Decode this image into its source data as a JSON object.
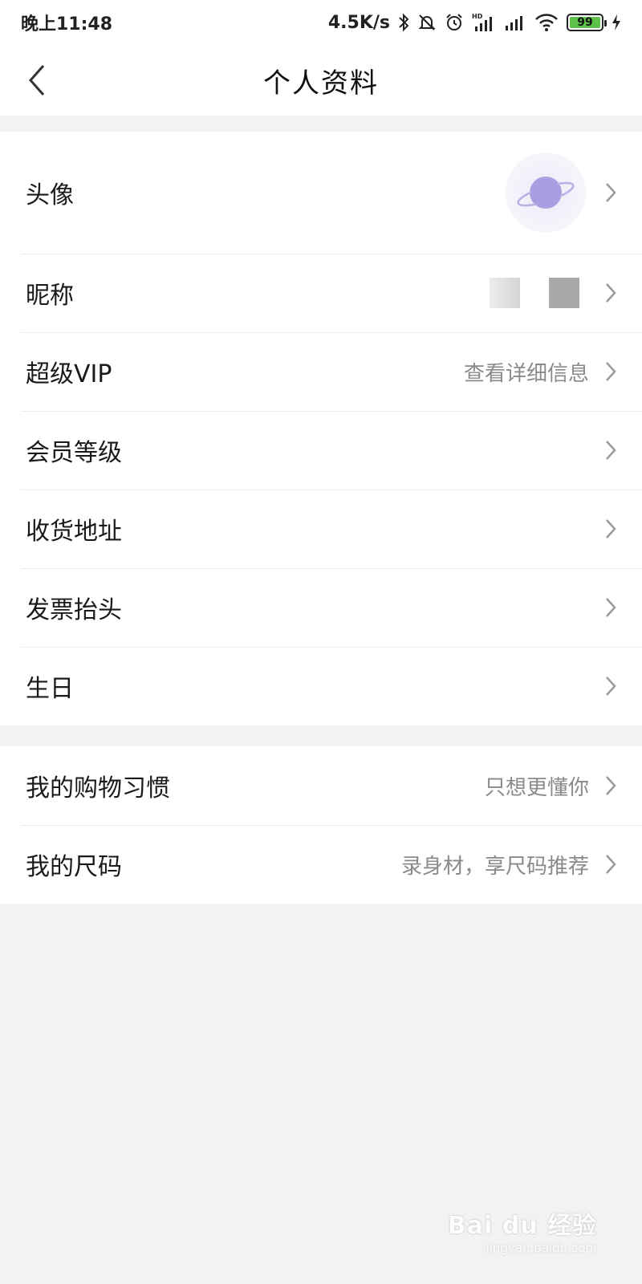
{
  "status_bar": {
    "time": "晚上11:48",
    "speed": "4.5K/s",
    "battery": "99"
  },
  "header": {
    "title": "个人资料"
  },
  "profile_items": [
    {
      "label": "头像",
      "value": ""
    },
    {
      "label": "昵称",
      "value": ""
    },
    {
      "label": "超级VIP",
      "value": "查看详细信息"
    },
    {
      "label": "会员等级",
      "value": ""
    },
    {
      "label": "收货地址",
      "value": ""
    },
    {
      "label": "发票抬头",
      "value": ""
    },
    {
      "label": "生日",
      "value": ""
    }
  ],
  "preference_items": [
    {
      "label": "我的购物习惯",
      "value": "只想更懂你"
    },
    {
      "label": "我的尺码",
      "value": "录身材，享尺码推荐"
    }
  ],
  "watermark": {
    "main": "Bai du 经验",
    "sub": "jingyan.baidu.com"
  },
  "colors": {
    "background": "#f2f2f2",
    "card": "#ffffff",
    "secondary_text": "#8a8a8a",
    "avatar_accent": "#a89ee0",
    "battery_fill": "#5ec24a"
  }
}
